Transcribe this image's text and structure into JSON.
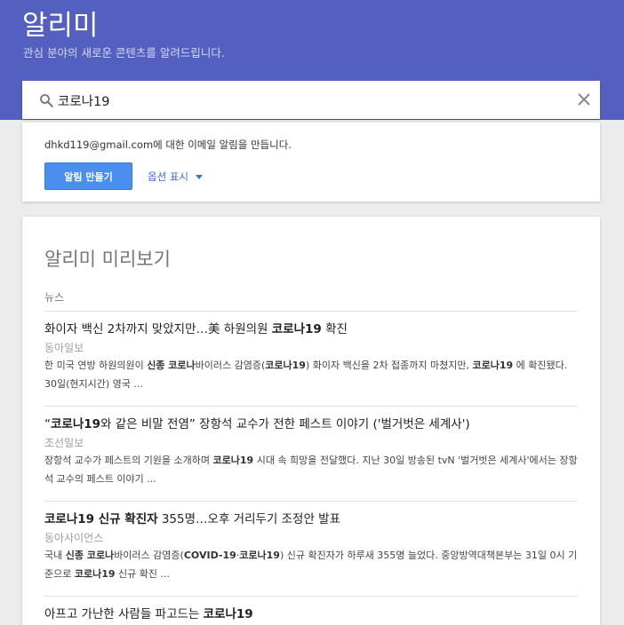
{
  "header": {
    "title": "알리미",
    "subtitle": "관심 분야의 새로운 콘텐츠를 알려드립니다."
  },
  "search": {
    "value": "코로나19",
    "search_icon": "search-icon",
    "clear_icon": "close-icon"
  },
  "create_card": {
    "email_text": "dhkd119@gmail.com에 대한 이메일 알림을 만듭니다.",
    "create_button": "알림 만들기",
    "options_label": "옵션 표시"
  },
  "preview": {
    "title": "알리미 미리보기",
    "section": "뉴스",
    "articles": [
      {
        "title": "화이자 백신 2차까지 맞았지만…美 하원의원 <b>코로나19</b> 확진",
        "source": "동아일보",
        "snippet": "한 미국 연방 하원의원이 <b>신종 코로나</b>바이러스 감염증(<b>코로나19</b>) 화이자 백신을 2차 접종까지 마쳤지만, <b>코로나19</b> 에 확진됐다. 30일(현지시간) 영국 ..."
      },
      {
        "title": "“<b>코로나19</b>와 같은 비말 전염” 장항석 교수가 전한 페스트 이야기 ('벌거벗은 세계사')",
        "source": "조선일보",
        "snippet": "장항석 교수가 페스트의 기원을 소개하며 <b>코로나19</b> 시대 속 희망을 전달했다. 지난 30일 방송된 tvN '벌거벗은 세계사'에서는 장항석 교수의 페스트 이야기 ..."
      },
      {
        "title": "<b>코로나19 신규 확진자</b> 355명…오후 거리두기 조정안 발표",
        "source": "동아사이언스",
        "snippet": "국내 <b>신종 코로나</b>바이러스 감염증(<b>COVID-19</b>·<b>코로나19</b>) 신규 확진자가 하루새 355명 늘었다. 중앙방역대책본부는 31일 0시 기준으로 <b>코로나19</b> 신규 확진 ..."
      },
      {
        "title": "아프고 가난한 사람들 파고드는 <b>코로나19</b>",
        "source": "",
        "snippet": ""
      }
    ]
  }
}
